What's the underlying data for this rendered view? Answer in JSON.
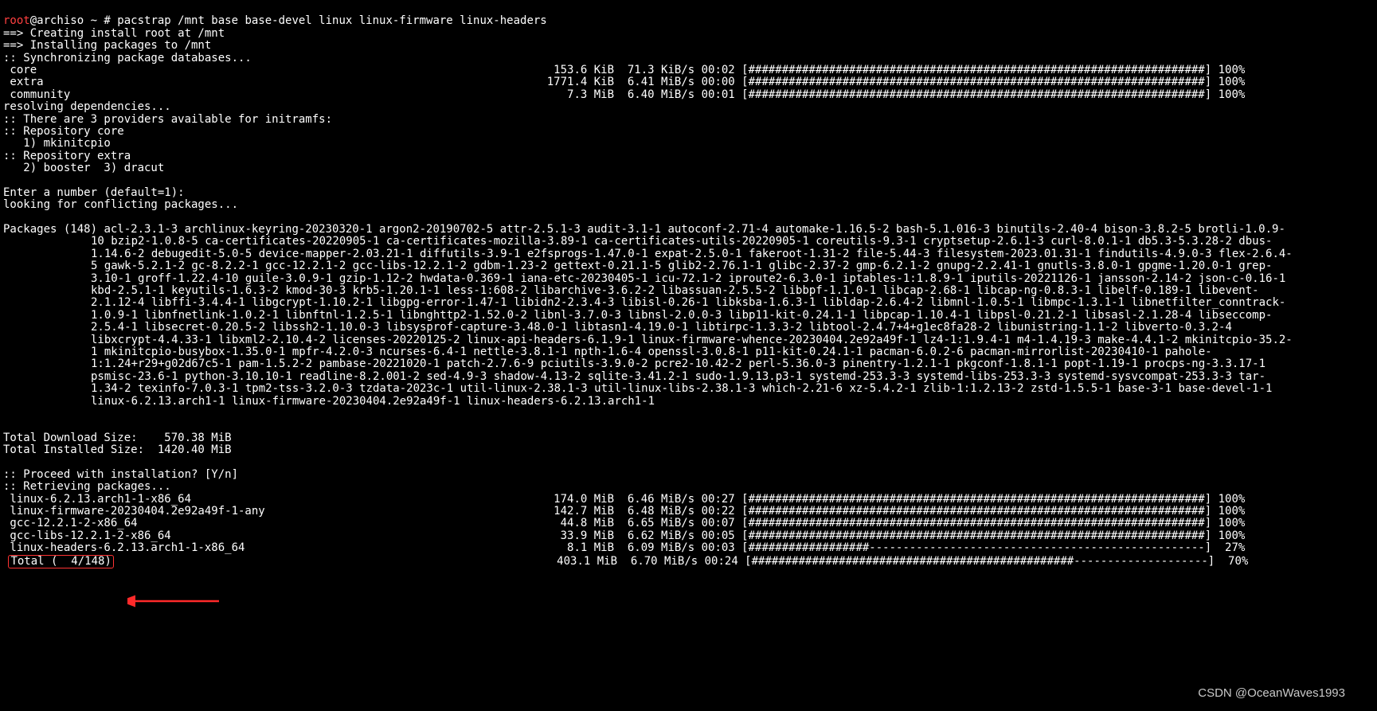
{
  "prompt": {
    "user": "root",
    "host": "@archiso ",
    "cwd": "~ # ",
    "command": "pacstrap /mnt base base-devel linux linux-firmware linux-headers"
  },
  "intro": {
    "l1": "==> Creating install root at /mnt",
    "l2": "==> Installing packages to /mnt",
    "l3": ":: Synchronizing package databases..."
  },
  "sync": {
    "core": {
      "name": " core",
      "size": "153.6 KiB",
      "speed": "71.3 KiB/s",
      "eta": "00:02",
      "pct": "100%",
      "fill": 68,
      "dash": 0
    },
    "extra": {
      "name": " extra",
      "size": "1771.4 KiB",
      "speed": "6.41 MiB/s",
      "eta": "00:00",
      "pct": "100%",
      "fill": 68,
      "dash": 0
    },
    "community": {
      "name": " community",
      "size": "7.3 MiB",
      "speed": "6.40 MiB/s",
      "eta": "00:01",
      "pct": "100%",
      "fill": 68,
      "dash": 0
    }
  },
  "resolve": {
    "l1": "resolving dependencies...",
    "l2": ":: There are 3 providers available for initramfs:",
    "l3": ":: Repository core",
    "l4": "   1) mkinitcpio",
    "l5": ":: Repository extra",
    "l6": "   2) booster  3) dracut",
    "l7": "",
    "l8": "Enter a number (default=1):",
    "l9": "looking for conflicting packages..."
  },
  "packages": {
    "header": "Packages (148) ",
    "list": "acl-2.3.1-3  archlinux-keyring-20230320-1  argon2-20190702-5  attr-2.5.1-3  audit-3.1-1  autoconf-2.71-4  automake-1.16.5-2  bash-5.1.016-3  binutils-2.40-4  bison-3.8.2-5  brotli-1.0.9-10  bzip2-1.0.8-5  ca-certificates-20220905-1  ca-certificates-mozilla-3.89-1  ca-certificates-utils-20220905-1  coreutils-9.3-1  cryptsetup-2.6.1-3  curl-8.0.1-1  db5.3-5.3.28-2  dbus-1.14.6-2  debugedit-5.0-5  device-mapper-2.03.21-1  diffutils-3.9-1  e2fsprogs-1.47.0-1  expat-2.5.0-1  fakeroot-1.31-2  file-5.44-3  filesystem-2023.01.31-1  findutils-4.9.0-3  flex-2.6.4-5  gawk-5.2.1-2  gc-8.2.2-1  gcc-12.2.1-2  gcc-libs-12.2.1-2  gdbm-1.23-2  gettext-0.21.1-5  glib2-2.76.1-1  glibc-2.37-2  gmp-6.2.1-2  gnupg-2.2.41-1  gnutls-3.8.0-1  gpgme-1.20.0-1  grep-3.10-1  groff-1.22.4-10  guile-3.0.9-1  gzip-1.12-2  hwdata-0.369-1  iana-etc-20230405-1  icu-72.1-2  iproute2-6.3.0-1  iptables-1:1.8.9-1  iputils-20221126-1  jansson-2.14-2  json-c-0.16-1  kbd-2.5.1-1  keyutils-1.6.3-2  kmod-30-3  krb5-1.20.1-1  less-1:608-2  libarchive-3.6.2-2  libassuan-2.5.5-2  libbpf-1.1.0-1  libcap-2.68-1  libcap-ng-0.8.3-1  libelf-0.189-1  libevent-2.1.12-4  libffi-3.4.4-1  libgcrypt-1.10.2-1  libgpg-error-1.47-1  libidn2-2.3.4-3  libisl-0.26-1  libksba-1.6.3-1  libldap-2.6.4-2  libmnl-1.0.5-1  libmpc-1.3.1-1  libnetfilter_conntrack-1.0.9-1  libnfnetlink-1.0.2-1  libnftnl-1.2.5-1  libnghttp2-1.52.0-2  libnl-3.7.0-3  libnsl-2.0.0-3  libp11-kit-0.24.1-1  libpcap-1.10.4-1  libpsl-0.21.2-1  libsasl-2.1.28-4  libseccomp-2.5.4-1  libsecret-0.20.5-2  libssh2-1.10.0-3  libsysprof-capture-3.48.0-1  libtasn1-4.19.0-1  libtirpc-1.3.3-2  libtool-2.4.7+4+g1ec8fa28-2  libunistring-1.1-2  libverto-0.3.2-4  libxcrypt-4.4.33-1  libxml2-2.10.4-2  licenses-20220125-2  linux-api-headers-6.1.9-1  linux-firmware-whence-20230404.2e92a49f-1  lz4-1:1.9.4-1  m4-1.4.19-3  make-4.4.1-2  mkinitcpio-35.2-1  mkinitcpio-busybox-1.35.0-1  mpfr-4.2.0-3  ncurses-6.4-1  nettle-3.8.1-1  npth-1.6-4  openssl-3.0.8-1  p11-kit-0.24.1-1  pacman-6.0.2-6  pacman-mirrorlist-20230410-1  pahole-1:1.24+r29+g02d67c5-1  pam-1.5.2-2  pambase-20221020-1  patch-2.7.6-9  pciutils-3.9.0-2  pcre2-10.42-2  perl-5.36.0-3  pinentry-1.2.1-1  pkgconf-1.8.1-1  popt-1.19-1  procps-ng-3.3.17-1  psmisc-23.6-1  python-3.10.10-1  readline-8.2.001-2  sed-4.9-3  shadow-4.13-2  sqlite-3.41.2-1  sudo-1.9.13.p3-1  systemd-253.3-3  systemd-libs-253.3-3  systemd-sysvcompat-253.3-3  tar-1.34-2  texinfo-7.0.3-1  tpm2-tss-3.2.0-3  tzdata-2023c-1  util-linux-2.38.1-3  util-linux-libs-2.38.1-3  which-2.21-6  xz-5.4.2-1  zlib-1:1.2.13-2  zstd-1.5.5-1  base-3-1  base-devel-1-1  linux-6.2.13.arch1-1  linux-firmware-20230404.2e92a49f-1  linux-headers-6.2.13.arch1-1"
  },
  "totals": {
    "dl": "Total Download Size:    570.38 MiB",
    "inst": "Total Installed Size:  1420.40 MiB"
  },
  "proceed": {
    "l1": ":: Proceed with installation? [Y/n]",
    "l2": ":: Retrieving packages..."
  },
  "downloads": {
    "r1": {
      "name": " linux-6.2.13.arch1-1-x86_64",
      "size": "174.0 MiB",
      "speed": "6.46 MiB/s",
      "eta": "00:27",
      "pct": "100%",
      "fill": 68,
      "dash": 0
    },
    "r2": {
      "name": " linux-firmware-20230404.2e92a49f-1-any",
      "size": "142.7 MiB",
      "speed": "6.48 MiB/s",
      "eta": "00:22",
      "pct": "100%",
      "fill": 68,
      "dash": 0
    },
    "r3": {
      "name": " gcc-12.2.1-2-x86_64",
      "size": "44.8 MiB",
      "speed": "6.65 MiB/s",
      "eta": "00:07",
      "pct": "100%",
      "fill": 68,
      "dash": 0
    },
    "r4": {
      "name": " gcc-libs-12.2.1-2-x86_64",
      "size": "33.9 MiB",
      "speed": "6.62 MiB/s",
      "eta": "00:05",
      "pct": "100%",
      "fill": 68,
      "dash": 0
    },
    "r5": {
      "name": " linux-headers-6.2.13.arch1-1-x86_64",
      "size": "8.1 MiB",
      "speed": "6.09 MiB/s",
      "eta": "00:03",
      "pct": " 27%",
      "fill": 18,
      "dash": 50
    },
    "r6": {
      "name_prefix": " ",
      "name_hl": "Total (  4/148)",
      "size": "403.1 MiB",
      "speed": "6.70 MiB/s",
      "eta": "00:24",
      "pct": " 70%",
      "fill": 48,
      "dash": 20
    }
  },
  "watermark": "CSDN @OceanWaves1993",
  "colors": {
    "root": "#ff4040",
    "highlight_border": "#ff3333",
    "arrow": "#ff2a2a"
  }
}
